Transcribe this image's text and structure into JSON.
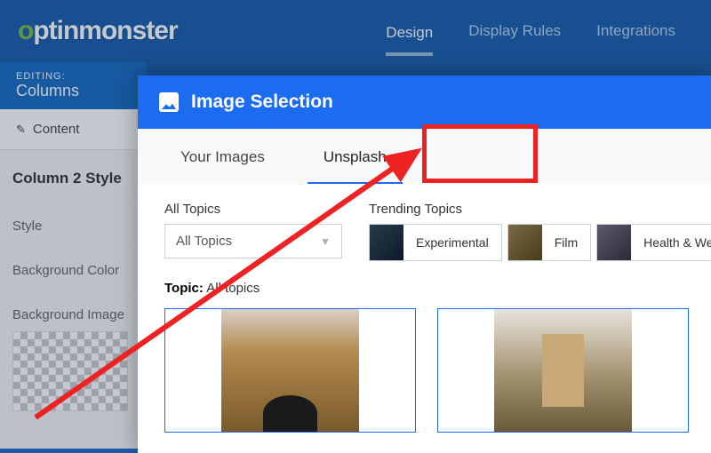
{
  "logo": {
    "green": "o",
    "rest": "ptinmonster"
  },
  "top_nav": {
    "design": "Design",
    "display_rules": "Display Rules",
    "integrations": "Integrations"
  },
  "sidebar": {
    "editing_label": "EDITING:",
    "editing_title": "Columns",
    "content_tab": "Content",
    "section_title": "Column 2 Style",
    "style": "Style",
    "bg_color": "Background Color",
    "bg_image": "Background Image"
  },
  "modal": {
    "title": "Image Selection",
    "tabs": {
      "your_images": "Your Images",
      "unsplash": "Unsplash"
    },
    "all_topics_label": "All Topics",
    "all_topics_value": "All Topics",
    "trending_label": "Trending Topics",
    "trending": {
      "experimental": "Experimental",
      "film": "Film",
      "health": "Health & Wellness"
    },
    "topic_label": "Topic:",
    "topic_value": "All topics"
  }
}
